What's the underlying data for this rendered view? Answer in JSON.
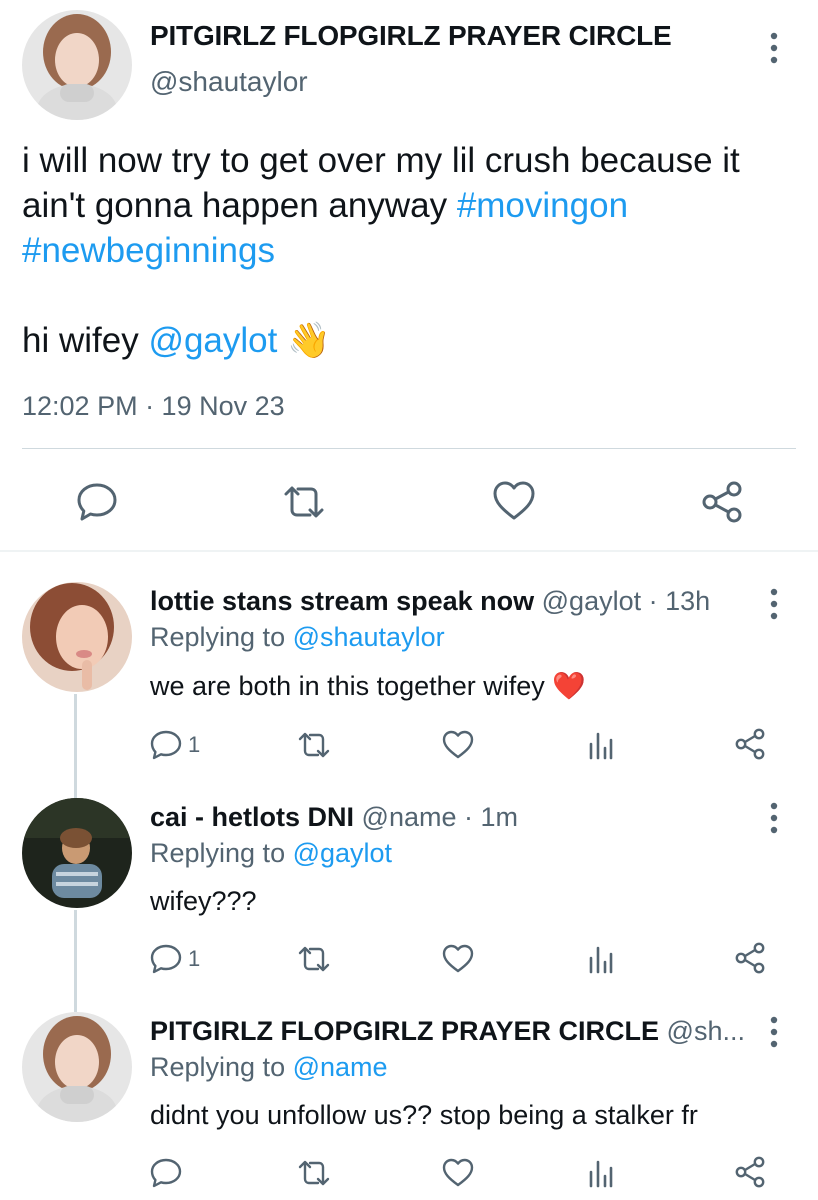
{
  "main_tweet": {
    "display_name": "PITGIRLZ FLOPGIRLZ PRAYER CIRCLE",
    "handle": "@shautaylor",
    "text_line1": "i will now try to get over my lil crush because it",
    "text_line2_plain": "ain't gonna happen anyway ",
    "hashtag1": "#movingon",
    "hashtag2": "#newbeginnings",
    "text_line4_plain": "hi wifey ",
    "mention": "@gaylot",
    "emoji": "👋",
    "timestamp": "12:02 PM · 19 Nov 23",
    "actions": [
      "reply-icon",
      "retweet-icon",
      "like-icon",
      "share-icon"
    ]
  },
  "replies": [
    {
      "display_name": "lottie stans stream speak now",
      "meta": " @gaylot · 13h",
      "replying_prefix": "Replying to ",
      "replying_to": "@shautaylor",
      "text": "we are both in this together wifey ",
      "emoji": "❤️",
      "reply_count": "1",
      "actions": [
        "reply-icon",
        "retweet-icon",
        "like-icon",
        "views-icon",
        "share-icon"
      ]
    },
    {
      "display_name": "cai - hetlots DNI",
      "meta": " @name · 1m",
      "replying_prefix": "Replying to ",
      "replying_to": "@gaylot",
      "text": "wifey???",
      "reply_count": "1",
      "actions": [
        "reply-icon",
        "retweet-icon",
        "like-icon",
        "views-icon",
        "share-icon"
      ]
    },
    {
      "display_name": "PITGIRLZ FLOPGIRLZ PRAYER CIRCLE",
      "meta": " @sh...",
      "replying_prefix": "Replying to ",
      "replying_to": "@name",
      "text": "didnt you unfollow us?? stop being a stalker fr",
      "reply_count": "",
      "actions": [
        "reply-icon",
        "retweet-icon",
        "like-icon",
        "views-icon",
        "share-icon"
      ]
    }
  ],
  "colors": {
    "link": "#1d9bf0",
    "muted": "#536471",
    "heart": "#e0245e"
  }
}
